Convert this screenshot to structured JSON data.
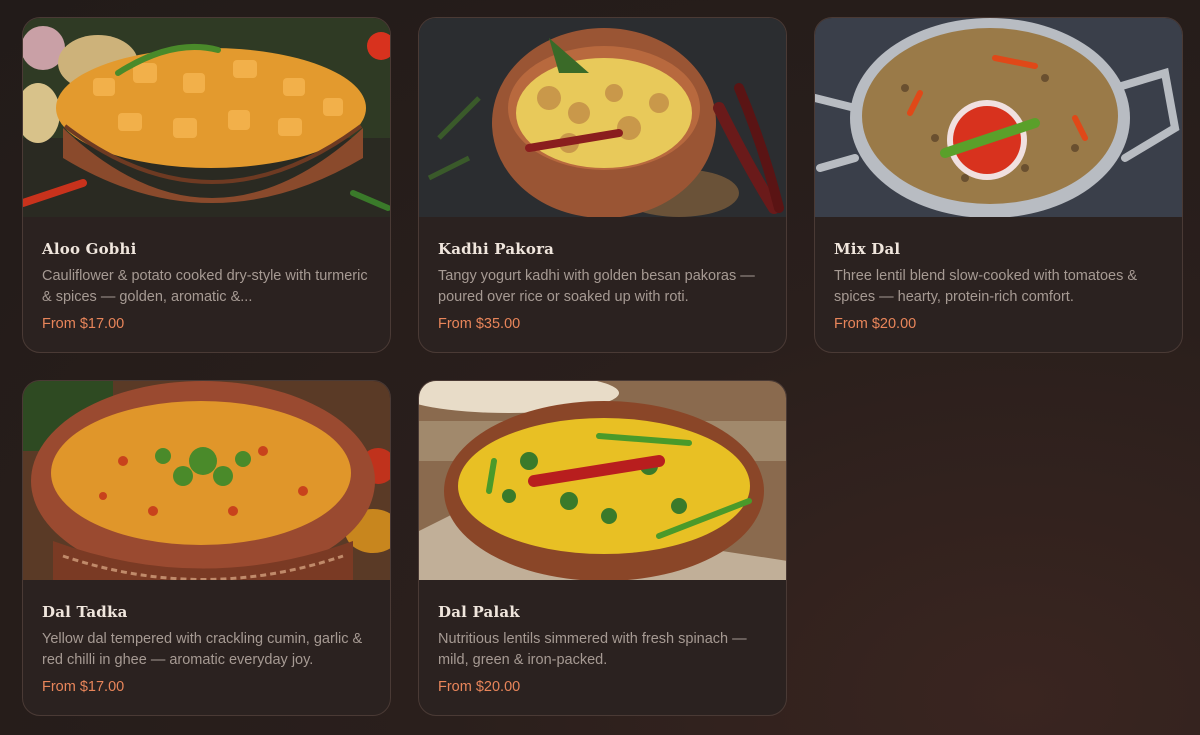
{
  "menu": {
    "items": [
      {
        "name": "Aloo Gobhi",
        "description": "Cauliflower & potato cooked dry-style with turmeric & spices — golden, aromatic &...",
        "price": "From $17.00",
        "photo_icon": "aloo-gobhi-photo",
        "colors": {
          "bg": "#2f3a24",
          "bowl": "#8a4a2c",
          "food": "#e39a2e"
        }
      },
      {
        "name": "Kadhi Pakora",
        "description": "Tangy yogurt kadhi with golden besan pakoras — poured over rice or soaked up with roti.",
        "price": "From $35.00",
        "photo_icon": "kadhi-pakora-photo",
        "colors": {
          "bg": "#2b2d30",
          "bowl": "#9a5534",
          "food": "#e8c95a"
        }
      },
      {
        "name": "Mix Dal",
        "description": "Three lentil blend slow-cooked with tomatoes & spices — hearty, protein-rich comfort.",
        "price": "From $20.00",
        "photo_icon": "mix-dal-photo",
        "colors": {
          "bg": "#3a3f4a",
          "bowl": "#b8bcc2",
          "food": "#9a7a48"
        }
      },
      {
        "name": "Dal Tadka",
        "description": "Yellow dal tempered with crackling cumin, garlic & red chilli in ghee — aromatic everyday joy.",
        "price": "From $17.00",
        "photo_icon": "dal-tadka-photo",
        "colors": {
          "bg": "#5a3a26",
          "bowl": "#9a4a30",
          "food": "#e0962a"
        }
      },
      {
        "name": "Dal Palak",
        "description": "Nutritious lentils simmered with fresh spinach — mild, green & iron-packed.",
        "price": "From $20.00",
        "photo_icon": "dal-palak-photo",
        "colors": {
          "bg": "#8a6a4e",
          "bowl": "#8a4628",
          "food": "#e8c024"
        }
      }
    ]
  }
}
